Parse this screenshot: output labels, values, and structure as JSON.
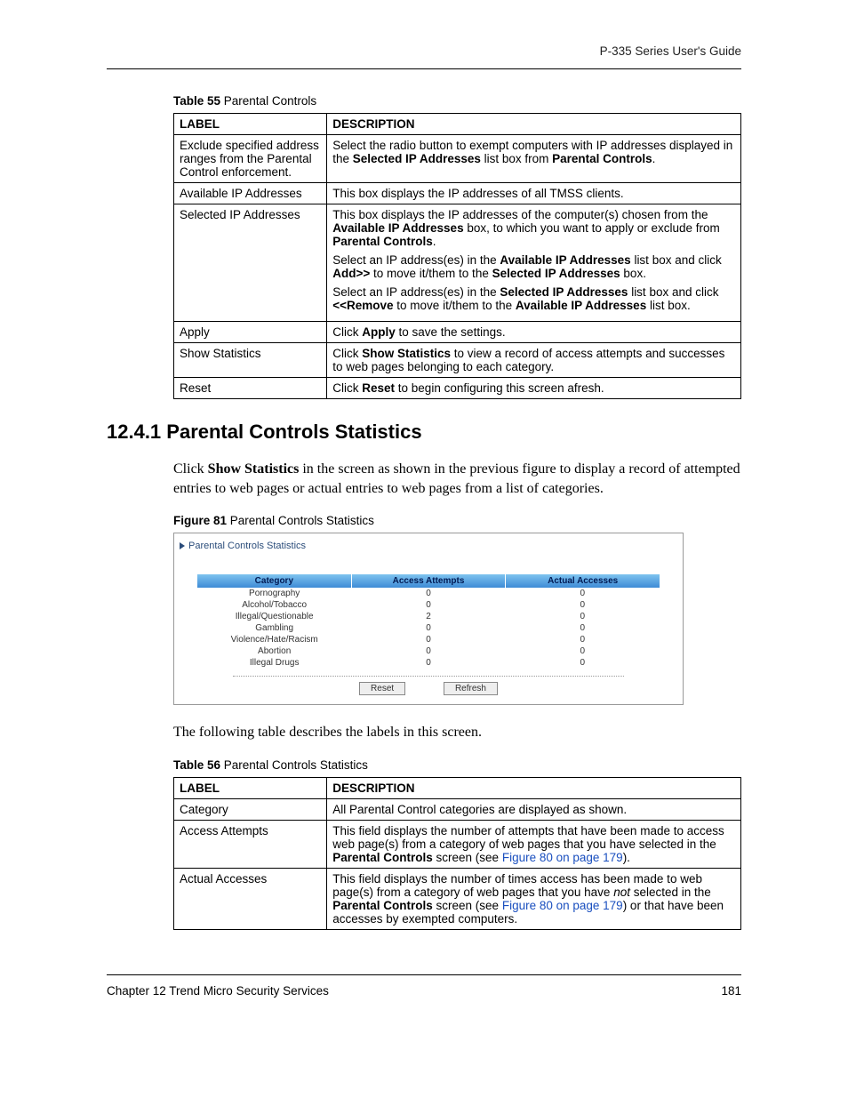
{
  "header": {
    "text": "P-335 Series User's Guide"
  },
  "table55": {
    "caption_strong": "Table 55",
    "caption_rest": "   Parental Controls",
    "head_label": "LABEL",
    "head_desc": "DESCRIPTION",
    "rows": [
      {
        "label": "Exclude specified address ranges from the Parental Control enforcement.",
        "desc_parts": [
          {
            "t": "Select the radio button to exempt computers with IP addresses displayed in the "
          },
          {
            "t": "Selected IP Addresses",
            "b": true
          },
          {
            "t": " list box from "
          },
          {
            "t": "Parental Controls",
            "b": true
          },
          {
            "t": "."
          }
        ]
      },
      {
        "label": "Available IP Addresses",
        "desc_parts": [
          {
            "t": "This box displays the IP addresses of all TMSS clients."
          }
        ]
      },
      {
        "label": "Selected IP Addresses",
        "multi": [
          [
            {
              "t": "This box displays the IP addresses of the computer(s) chosen from the "
            },
            {
              "t": "Available IP Addresses",
              "b": true
            },
            {
              "t": " box, to which you want to apply or exclude from "
            },
            {
              "t": "Parental Controls",
              "b": true
            },
            {
              "t": "."
            }
          ],
          [
            {
              "t": "Select an IP address(es) in the "
            },
            {
              "t": "Available IP Addresses",
              "b": true
            },
            {
              "t": " list box and click "
            },
            {
              "t": "Add>>",
              "b": true
            },
            {
              "t": " to move it/them  to the "
            },
            {
              "t": "Selected IP Addresses",
              "b": true
            },
            {
              "t": " box."
            }
          ],
          [
            {
              "t": "Select an IP address(es) in the "
            },
            {
              "t": "Selected IP Addresses",
              "b": true
            },
            {
              "t": " list box and click "
            },
            {
              "t": "<<Remove",
              "b": true
            },
            {
              "t": " to move it/them  to the "
            },
            {
              "t": "Available IP Addresses",
              "b": true
            },
            {
              "t": " list box."
            }
          ]
        ]
      },
      {
        "label": "Apply",
        "desc_parts": [
          {
            "t": "Click "
          },
          {
            "t": "Apply",
            "b": true
          },
          {
            "t": " to save the settings."
          }
        ]
      },
      {
        "label": "Show Statistics",
        "desc_parts": [
          {
            "t": "Click "
          },
          {
            "t": "Show Statistics",
            "b": true
          },
          {
            "t": " to view a record of access attempts and successes to web pages belonging to each category."
          }
        ]
      },
      {
        "label": "Reset",
        "desc_parts": [
          {
            "t": "Click "
          },
          {
            "t": "Reset",
            "b": true
          },
          {
            "t": " to begin configuring this screen afresh."
          }
        ]
      }
    ]
  },
  "section_heading": "12.4.1  Parental Controls Statistics",
  "intro_para_parts": [
    {
      "t": "Click "
    },
    {
      "t": "Show Statistics",
      "b": true
    },
    {
      "t": " in the screen as shown in the previous figure to display a record of attempted entries to web pages or actual entries to web pages from a list of categories."
    }
  ],
  "figure81": {
    "caption_strong": "Figure 81",
    "caption_rest": "   Parental Controls Statistics",
    "panel_title": "Parental Controls Statistics",
    "headers": [
      "Category",
      "Access Attempts",
      "Actual Accesses"
    ],
    "rows": [
      [
        "Pornography",
        "0",
        "0"
      ],
      [
        "Alcohol/Tobacco",
        "0",
        "0"
      ],
      [
        "Illegal/Questionable",
        "2",
        "0"
      ],
      [
        "Gambling",
        "0",
        "0"
      ],
      [
        "Violence/Hate/Racism",
        "0",
        "0"
      ],
      [
        "Abortion",
        "0",
        "0"
      ],
      [
        "Illegal Drugs",
        "0",
        "0"
      ]
    ],
    "btn_reset": "Reset",
    "btn_refresh": "Refresh"
  },
  "after_fig_para": "The following table describes the labels in this screen.",
  "table56": {
    "caption_strong": "Table 56",
    "caption_rest": "   Parental Controls Statistics",
    "head_label": "LABEL",
    "head_desc": "DESCRIPTION",
    "rows": [
      {
        "label": "Category",
        "desc_parts": [
          {
            "t": "All Parental Control categories are displayed as shown."
          }
        ]
      },
      {
        "label": "Access Attempts",
        "desc_parts": [
          {
            "t": "This field displays the number of attempts that have been made to access web page(s) from a category of web pages that you have selected in the "
          },
          {
            "t": "Parental Controls",
            "b": true
          },
          {
            "t": " screen (see "
          },
          {
            "t": "Figure 80 on page 179",
            "link": true
          },
          {
            "t": ")."
          }
        ]
      },
      {
        "label": "Actual Accesses",
        "desc_parts": [
          {
            "t": "This field displays the number of times access has been made to web page(s) from a category of web pages that you have "
          },
          {
            "t": "not",
            "i": true
          },
          {
            "t": " selected in the "
          },
          {
            "t": "Parental Controls",
            "b": true
          },
          {
            "t": " screen (see "
          },
          {
            "t": "Figure 80 on page 179",
            "link": true
          },
          {
            "t": ") or that have been accesses by exempted computers."
          }
        ]
      }
    ]
  },
  "footer": {
    "left": "Chapter 12 Trend Micro Security Services",
    "right": "181"
  }
}
